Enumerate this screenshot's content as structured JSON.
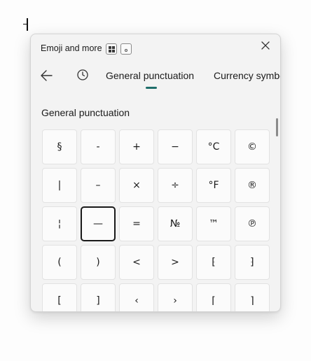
{
  "window": {
    "title": "Emoji and more",
    "shortcut_icons": [
      "windows-key-icon",
      "period-key-icon"
    ]
  },
  "nav": {
    "back_icon": "back-arrow-icon",
    "recent_icon": "clock-icon",
    "tabs": [
      {
        "label": "General punctuation",
        "active": true
      },
      {
        "label": "Currency symbo",
        "active": false
      }
    ]
  },
  "section": {
    "title": "General punctuation"
  },
  "symbols": [
    "§",
    "-",
    "+",
    "−",
    "°C",
    "©",
    "|",
    "–",
    "×",
    "÷",
    "°F",
    "®",
    "¦",
    "—",
    "=",
    "№",
    "™",
    "℗",
    "(",
    ")",
    "<",
    ">",
    "⁅",
    "⁆",
    "[",
    "]",
    "‹",
    "›",
    "⌈",
    "⌉"
  ],
  "selected_index": 13,
  "colors": {
    "accent": "#1f6e6a",
    "panel_bg": "#f3f3f3",
    "cell_bg": "#fbfbfb"
  }
}
